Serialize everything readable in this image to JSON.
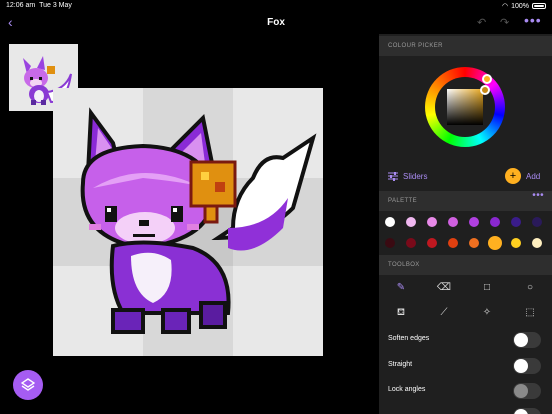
{
  "status_bar": {
    "time": "12:06 am",
    "date": "Tue 3 May",
    "battery": "100%"
  },
  "header": {
    "title": "Fox"
  },
  "colour_picker": {
    "heading": "COLOUR PICKER",
    "sliders_label": "Sliders",
    "add_label": "Add",
    "selected_color": "#c98a18"
  },
  "palette": {
    "heading": "PALETTE",
    "row1": [
      "#ffffff",
      "#f0b8f0",
      "#e88ae8",
      "#d060e0",
      "#b040e0",
      "#8a28d0",
      "#3a1c8a",
      "#2a1a5a"
    ],
    "row2": [
      "#3a0a12",
      "#7a0a1a",
      "#c01820",
      "#e04010",
      "#f07020",
      "#ffb020",
      "#ffd020",
      "#fff0c0"
    ]
  },
  "toolbox": {
    "heading": "TOOLBOX",
    "tools": [
      "pencil-icon",
      "eraser-icon",
      "rectangle-icon",
      "circle-icon",
      "fill-icon",
      "eyedropper-icon",
      "magic-wand-icon",
      "selection-icon"
    ],
    "toggles": [
      {
        "label": "Soften edges",
        "on": false
      },
      {
        "label": "Straight",
        "on": false
      },
      {
        "label": "Lock angles",
        "on": false
      }
    ]
  },
  "colors": {
    "accent": "#a98bf2",
    "panel": "#1f1f1f",
    "section": "#2e2e2e",
    "layers_button": "#a55cf2"
  }
}
